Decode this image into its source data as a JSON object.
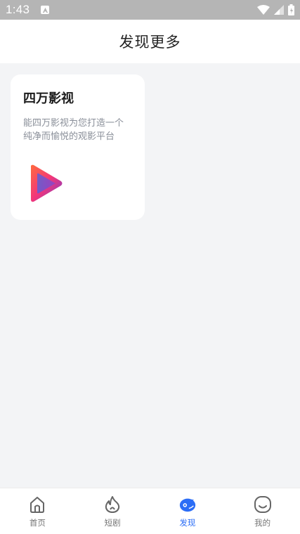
{
  "status_bar": {
    "time": "1:43"
  },
  "header": {
    "title": "发现更多"
  },
  "card": {
    "title": "四万影视",
    "description": "能四万影视为您打造一个纯净而愉悦的观影平台"
  },
  "bottom_nav": {
    "items": [
      {
        "label": "首页",
        "icon": "home-icon",
        "active": false
      },
      {
        "label": "短剧",
        "icon": "flame-icon",
        "active": false
      },
      {
        "label": "发现",
        "icon": "discover-icon",
        "active": true
      },
      {
        "label": "我的",
        "icon": "smile-icon",
        "active": false
      }
    ]
  },
  "colors": {
    "accent": "#2b6df6",
    "background": "#f3f4f6",
    "status_bar": "#b5b5b5"
  }
}
